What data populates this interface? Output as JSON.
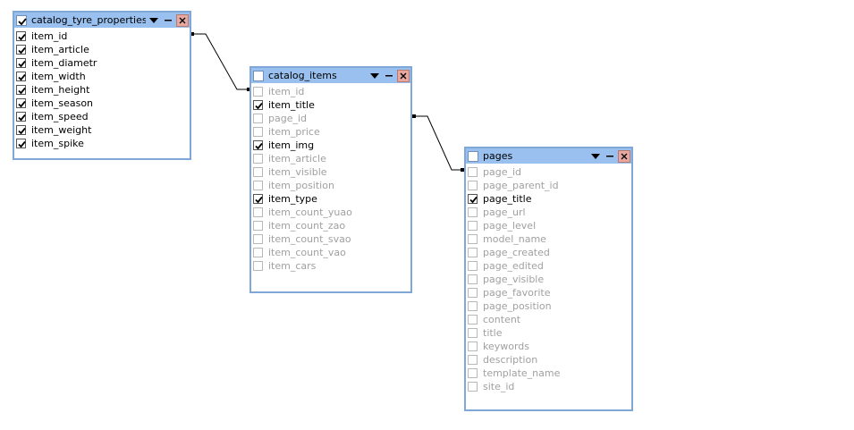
{
  "colors": {
    "title_bar": "#99c0ee",
    "border": "#7fa8d8",
    "close_button": "#e8a8a0",
    "checked_text": "#000000",
    "unchecked_text": "#a0a0a0"
  },
  "tables": [
    {
      "name": "catalog_tyre_properties",
      "title_checked": true,
      "fields": [
        {
          "label": "item_id",
          "checked": true
        },
        {
          "label": "item_article",
          "checked": true
        },
        {
          "label": "item_diametr",
          "checked": true
        },
        {
          "label": "item_width",
          "checked": true
        },
        {
          "label": "item_height",
          "checked": true
        },
        {
          "label": "item_season",
          "checked": true
        },
        {
          "label": "item_speed",
          "checked": true
        },
        {
          "label": "item_weight",
          "checked": true
        },
        {
          "label": "item_spike",
          "checked": true
        }
      ]
    },
    {
      "name": "catalog_items",
      "title_checked": false,
      "fields": [
        {
          "label": "item_id",
          "checked": false
        },
        {
          "label": "item_title",
          "checked": true
        },
        {
          "label": "page_id",
          "checked": false
        },
        {
          "label": "item_price",
          "checked": false
        },
        {
          "label": "item_img",
          "checked": true
        },
        {
          "label": "item_article",
          "checked": false
        },
        {
          "label": "item_visible",
          "checked": false
        },
        {
          "label": "item_position",
          "checked": false
        },
        {
          "label": "item_type",
          "checked": true
        },
        {
          "label": "item_count_yuao",
          "checked": false
        },
        {
          "label": "item_count_zao",
          "checked": false
        },
        {
          "label": "item_count_svao",
          "checked": false
        },
        {
          "label": "item_count_vao",
          "checked": false
        },
        {
          "label": "item_cars",
          "checked": false
        }
      ]
    },
    {
      "name": "pages",
      "title_checked": false,
      "fields": [
        {
          "label": "page_id",
          "checked": false
        },
        {
          "label": "page_parent_id",
          "checked": false
        },
        {
          "label": "page_title",
          "checked": true
        },
        {
          "label": "page_url",
          "checked": false
        },
        {
          "label": "page_level",
          "checked": false
        },
        {
          "label": "model_name",
          "checked": false
        },
        {
          "label": "page_created",
          "checked": false
        },
        {
          "label": "page_edited",
          "checked": false
        },
        {
          "label": "page_visible",
          "checked": false
        },
        {
          "label": "page_favorite",
          "checked": false
        },
        {
          "label": "page_position",
          "checked": false
        },
        {
          "label": "content",
          "checked": false
        },
        {
          "label": "title",
          "checked": false
        },
        {
          "label": "keywords",
          "checked": false
        },
        {
          "label": "description",
          "checked": false
        },
        {
          "label": "template_name",
          "checked": false
        },
        {
          "label": "site_id",
          "checked": false
        }
      ]
    }
  ]
}
